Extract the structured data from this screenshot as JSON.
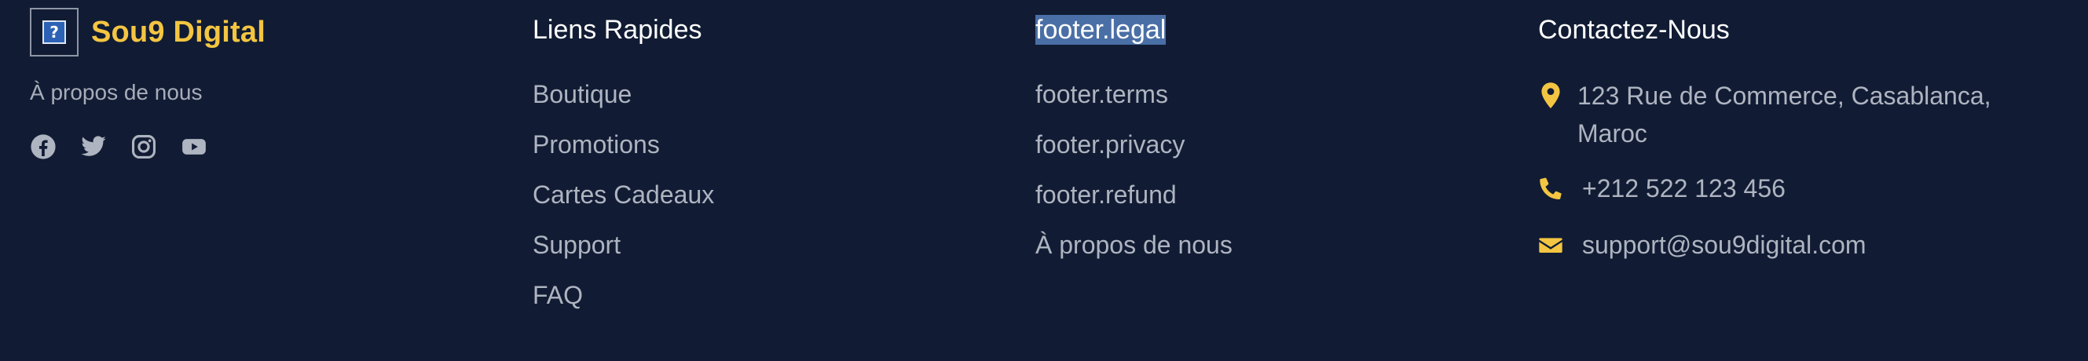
{
  "brand": {
    "logo_glyph": "?",
    "name": "Sou9 Digital",
    "about": "À propos de nous",
    "accent_color": "#f4c542"
  },
  "social": {
    "icons": [
      "facebook-icon",
      "twitter-icon",
      "instagram-icon",
      "youtube-icon"
    ]
  },
  "quick_links": {
    "title": "Liens Rapides",
    "items": [
      "Boutique",
      "Promotions",
      "Cartes Cadeaux",
      "Support",
      "FAQ"
    ]
  },
  "legal": {
    "title": "footer.legal",
    "title_selected": true,
    "items": [
      "footer.terms",
      "footer.privacy",
      "footer.refund",
      "À propos de nous"
    ]
  },
  "contact": {
    "title": "Contactez-Nous",
    "address": "123 Rue de Commerce, Casablanca, Maroc",
    "phone": "+212 522 123 456",
    "email": "support@sou9digital.com"
  },
  "colors": {
    "background": "#111c34",
    "text_muted": "#aeb4c0",
    "heading": "#ffffff",
    "selection": "#4a6fa6"
  }
}
